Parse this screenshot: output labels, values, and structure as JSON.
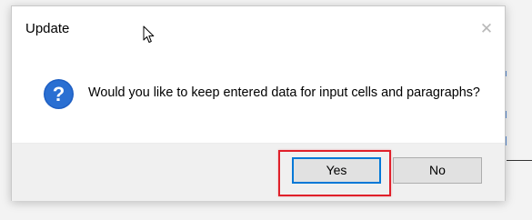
{
  "dialog": {
    "title": "Update",
    "close_icon": "close-icon",
    "message": "Would you like to keep entered data for input cells and paragraphs?",
    "message_icon": "question-icon",
    "buttons": {
      "yes_label": "Yes",
      "no_label": "No"
    }
  },
  "colors": {
    "accent": "#0078d7",
    "highlight": "#e0202a",
    "footer_bg": "#f0f0f0",
    "dialog_bg": "#ffffff"
  }
}
